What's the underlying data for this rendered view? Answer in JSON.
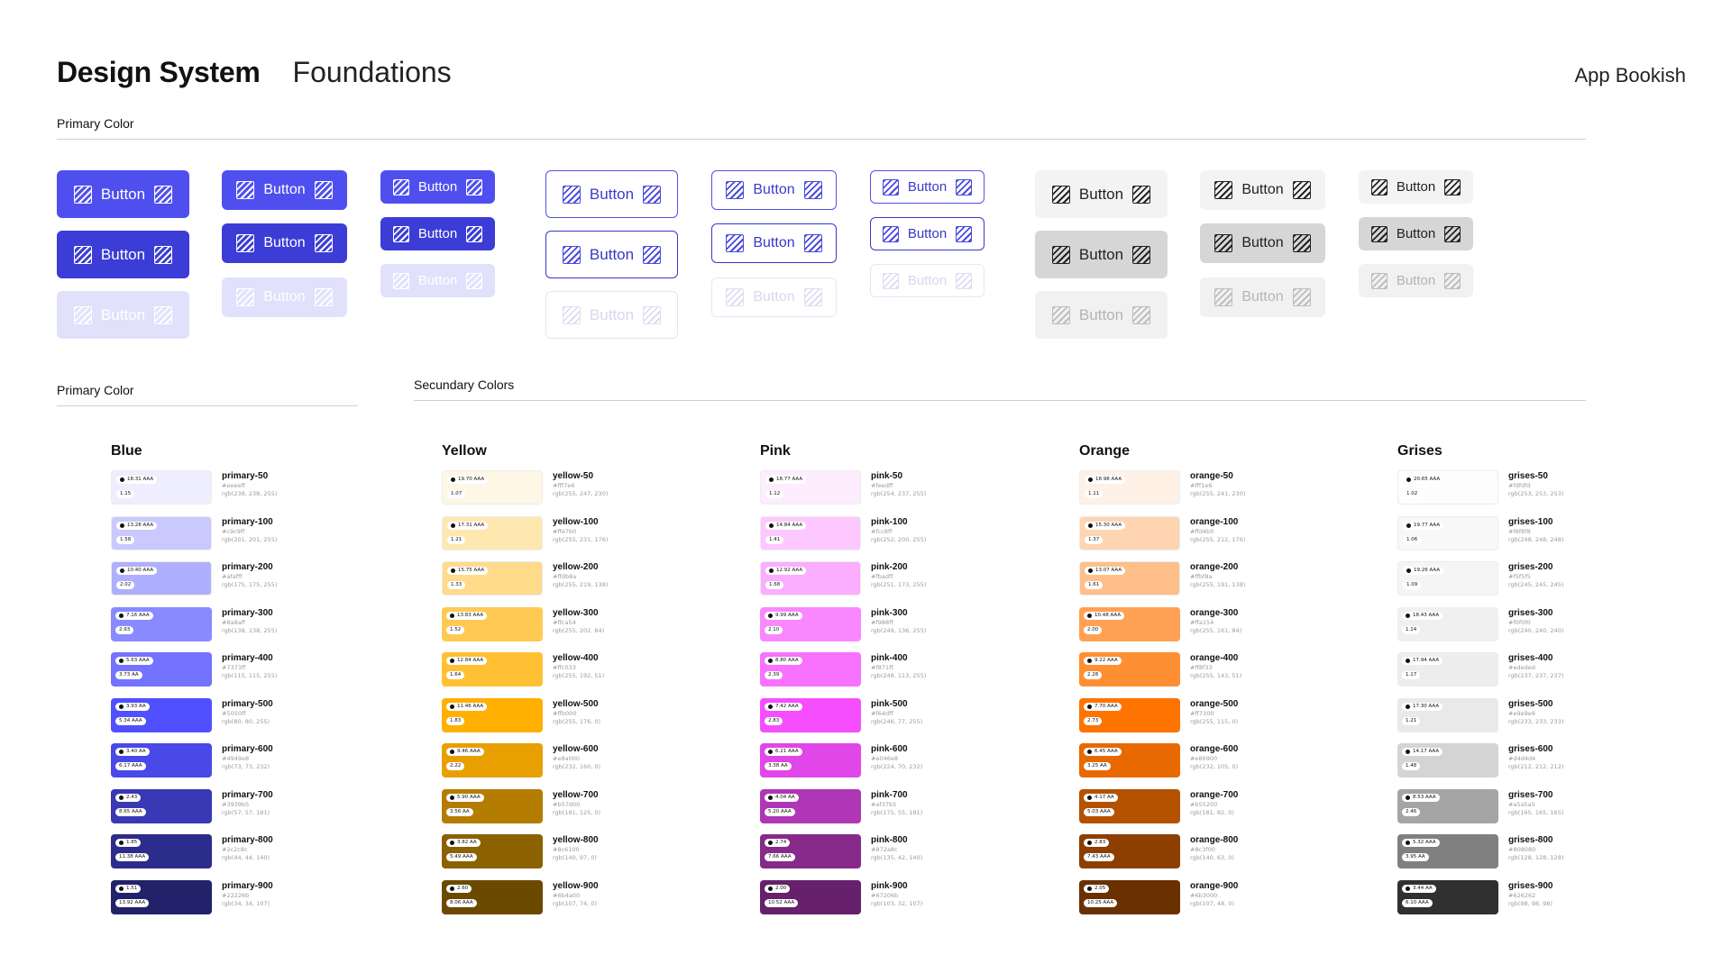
{
  "header": {
    "title": "Design System",
    "subtitle": "Foundations",
    "app_name": "App Bookish"
  },
  "sections": {
    "buttons_label": "Primary Color",
    "primary_label": "Primary Color",
    "secondary_label": "Secundary Colors"
  },
  "buttons": {
    "label": "Button",
    "icon": "hatch-square-icon"
  },
  "colors": {
    "solid": [
      "#4f4ff0",
      "#3c3cd6",
      "#e1e1fc"
    ],
    "outline": [
      "#5252e8",
      "#3737c8",
      "#e6e6f2"
    ],
    "gray": [
      "#f3f3f3",
      "#d6d6d6",
      "#f1f1f1"
    ]
  },
  "palettes": [
    {
      "title": "Blue",
      "shades": [
        {
          "name": "primary-50",
          "hex": "#eeeeff",
          "rgb": "rgb(238, 238, 255)",
          "color": "#eeeeff",
          "c1": "18.31 AAA",
          "c2": "1.15"
        },
        {
          "name": "primary-100",
          "hex": "#c9c9ff",
          "rgb": "rgb(201, 201, 255)",
          "color": "#c9c9ff",
          "c1": "13.28 AAA",
          "c2": "1.58"
        },
        {
          "name": "primary-200",
          "hex": "#afafff",
          "rgb": "rgb(175, 175, 255)",
          "color": "#afafff",
          "c1": "10.40 AAA",
          "c2": "2.02"
        },
        {
          "name": "primary-300",
          "hex": "#8a8aff",
          "rgb": "rgb(138, 138, 255)",
          "color": "#8a8aff",
          "c1": "7.16 AAA",
          "c2": "2.93"
        },
        {
          "name": "primary-400",
          "hex": "#7373ff",
          "rgb": "rgb(115, 115, 255)",
          "color": "#7373ff",
          "c1": "5.63 AAA",
          "c2": "3.73 AA"
        },
        {
          "name": "primary-500",
          "hex": "#5050ff",
          "rgb": "rgb(80, 80, 255)",
          "color": "#5050ff",
          "c1": "3.93 AA",
          "c2": "5.34 AAA"
        },
        {
          "name": "primary-600",
          "hex": "#4949e8",
          "rgb": "rgb(73, 73, 232)",
          "color": "#4949e8",
          "c1": "3.40 AA",
          "c2": "6.17 AAA"
        },
        {
          "name": "primary-700",
          "hex": "#3939b5",
          "rgb": "rgb(57, 57, 181)",
          "color": "#3939b5",
          "c1": "2.43",
          "c2": "8.65 AAA"
        },
        {
          "name": "primary-800",
          "hex": "#2c2c8c",
          "rgb": "rgb(44, 44, 140)",
          "color": "#2c2c8c",
          "c1": "1.85",
          "c2": "11.38 AAA"
        },
        {
          "name": "primary-900",
          "hex": "#22226b",
          "rgb": "rgb(34, 34, 107)",
          "color": "#22226b",
          "c1": "1.51",
          "c2": "13.92 AAA"
        }
      ]
    },
    {
      "title": "Yellow",
      "shades": [
        {
          "name": "yellow-50",
          "hex": "#fff7e6",
          "rgb": "rgb(255, 247, 230)",
          "color": "#fff7e6",
          "c1": "19.70 AAA",
          "c2": "1.07"
        },
        {
          "name": "yellow-100",
          "hex": "#ffe7b0",
          "rgb": "rgb(255, 231, 176)",
          "color": "#ffe7b0",
          "c1": "17.31 AAA",
          "c2": "1.21"
        },
        {
          "name": "yellow-200",
          "hex": "#ffdb8a",
          "rgb": "rgb(255, 219, 138)",
          "color": "#ffdb8a",
          "c1": "15.75 AAA",
          "c2": "1.33"
        },
        {
          "name": "yellow-300",
          "hex": "#ffca54",
          "rgb": "rgb(255, 202, 84)",
          "color": "#ffca54",
          "c1": "13.83 AAA",
          "c2": "1.52"
        },
        {
          "name": "yellow-400",
          "hex": "#ffc033",
          "rgb": "rgb(255, 192, 51)",
          "color": "#ffc033",
          "c1": "12.84 AAA",
          "c2": "1.64"
        },
        {
          "name": "yellow-500",
          "hex": "#ffb000",
          "rgb": "rgb(255, 176, 0)",
          "color": "#ffb000",
          "c1": "11.46 AAA",
          "c2": "1.83"
        },
        {
          "name": "yellow-600",
          "hex": "#e8a000",
          "rgb": "rgb(232, 160, 0)",
          "color": "#e8a000",
          "c1": "9.46 AAA",
          "c2": "2.22"
        },
        {
          "name": "yellow-700",
          "hex": "#b57d00",
          "rgb": "rgb(181, 125, 0)",
          "color": "#b57d00",
          "c1": "5.90 AAA",
          "c2": "3.56 AA"
        },
        {
          "name": "yellow-800",
          "hex": "#8c6100",
          "rgb": "rgb(140, 97, 0)",
          "color": "#8c6100",
          "c1": "3.82 AA",
          "c2": "5.49 AAA"
        },
        {
          "name": "yellow-900",
          "hex": "#6b4a00",
          "rgb": "rgb(107, 74, 0)",
          "color": "#6b4a00",
          "c1": "2.60",
          "c2": "8.06 AAA"
        }
      ]
    },
    {
      "title": "Pink",
      "shades": [
        {
          "name": "pink-50",
          "hex": "#feedff",
          "rgb": "rgb(254, 237, 255)",
          "color": "#feedff",
          "c1": "18.77 AAA",
          "c2": "1.12"
        },
        {
          "name": "pink-100",
          "hex": "#fcc8ff",
          "rgb": "rgb(252, 200, 255)",
          "color": "#fcc8ff",
          "c1": "14.84 AAA",
          "c2": "1.41"
        },
        {
          "name": "pink-200",
          "hex": "#fbadff",
          "rgb": "rgb(251, 173, 255)",
          "color": "#fbadff",
          "c1": "12.92 AAA",
          "c2": "1.68"
        },
        {
          "name": "pink-300",
          "hex": "#f988ff",
          "rgb": "rgb(249, 136, 255)",
          "color": "#f988ff",
          "c1": "9.99 AAA",
          "c2": "2.10"
        },
        {
          "name": "pink-400",
          "hex": "#f871ff",
          "rgb": "rgb(248, 113, 255)",
          "color": "#f871ff",
          "c1": "8.80 AAA",
          "c2": "2.39"
        },
        {
          "name": "pink-500",
          "hex": "#f64dff",
          "rgb": "rgb(246, 77, 255)",
          "color": "#f64dff",
          "c1": "7.42 AAA",
          "c2": "2.83"
        },
        {
          "name": "pink-600",
          "hex": "#e046e8",
          "rgb": "rgb(224, 70, 232)",
          "color": "#e046e8",
          "c1": "6.21 AAA",
          "c2": "3.38 AA"
        },
        {
          "name": "pink-700",
          "hex": "#af37b5",
          "rgb": "rgb(175, 55, 181)",
          "color": "#af37b5",
          "c1": "4.04 AA",
          "c2": "5.20 AAA"
        },
        {
          "name": "pink-800",
          "hex": "#872a8c",
          "rgb": "rgb(135, 42, 140)",
          "color": "#872a8c",
          "c1": "2.74",
          "c2": "7.66 AAA"
        },
        {
          "name": "pink-900",
          "hex": "#67206b",
          "rgb": "rgb(103, 32, 107)",
          "color": "#67206b",
          "c1": "2.00",
          "c2": "10.52 AAA"
        }
      ]
    },
    {
      "title": "Orange",
      "shades": [
        {
          "name": "orange-50",
          "hex": "#fff1e6",
          "rgb": "rgb(255, 241, 230)",
          "color": "#fff1e6",
          "c1": "18.98 AAA",
          "c2": "1.11"
        },
        {
          "name": "orange-100",
          "hex": "#ffd4b0",
          "rgb": "rgb(255, 212, 176)",
          "color": "#ffd4b0",
          "c1": "15.30 AAA",
          "c2": "1.37"
        },
        {
          "name": "orange-200",
          "hex": "#ffbf8a",
          "rgb": "rgb(255, 191, 138)",
          "color": "#ffbf8a",
          "c1": "13.07 AAA",
          "c2": "1.61"
        },
        {
          "name": "orange-300",
          "hex": "#ffa154",
          "rgb": "rgb(255, 161, 84)",
          "color": "#ffa154",
          "c1": "10.48 AAA",
          "c2": "2.00"
        },
        {
          "name": "orange-400",
          "hex": "#ff8f33",
          "rgb": "rgb(255, 143, 51)",
          "color": "#ff8f33",
          "c1": "9.22 AAA",
          "c2": "2.28"
        },
        {
          "name": "orange-500",
          "hex": "#ff7300",
          "rgb": "rgb(255, 115, 0)",
          "color": "#ff7300",
          "c1": "7.70 AAA",
          "c2": "2.73"
        },
        {
          "name": "orange-600",
          "hex": "#e86900",
          "rgb": "rgb(232, 105, 0)",
          "color": "#e86900",
          "c1": "6.45 AAA",
          "c2": "3.25 AA"
        },
        {
          "name": "orange-700",
          "hex": "#b55200",
          "rgb": "rgb(181, 82, 0)",
          "color": "#b55200",
          "c1": "4.17 AA",
          "c2": "5.03 AAA"
        },
        {
          "name": "orange-800",
          "hex": "#8c3f00",
          "rgb": "rgb(140, 63, 0)",
          "color": "#8c3f00",
          "c1": "2.83",
          "c2": "7.43 AAA"
        },
        {
          "name": "orange-900",
          "hex": "#6b3000",
          "rgb": "rgb(107, 48, 0)",
          "color": "#6b3000",
          "c1": "2.05",
          "c2": "10.25 AAA"
        }
      ]
    },
    {
      "title": "Grises",
      "shades": [
        {
          "name": "grises-50",
          "hex": "#fdfdfd",
          "rgb": "rgb(253, 253, 253)",
          "color": "#fdfdfd",
          "c1": "20.65 AAA",
          "c2": "1.02"
        },
        {
          "name": "grises-100",
          "hex": "#f8f8f8",
          "rgb": "rgb(248, 248, 248)",
          "color": "#f8f8f8",
          "c1": "19.77 AAA",
          "c2": "1.06"
        },
        {
          "name": "grises-200",
          "hex": "#f5f5f5",
          "rgb": "rgb(245, 245, 245)",
          "color": "#f5f5f5",
          "c1": "19.26 AAA",
          "c2": "1.09"
        },
        {
          "name": "grises-300",
          "hex": "#f0f0f0",
          "rgb": "rgb(240, 240, 240)",
          "color": "#f0f0f0",
          "c1": "18.43 AAA",
          "c2": "1.14"
        },
        {
          "name": "grises-400",
          "hex": "#ededed",
          "rgb": "rgb(237, 237, 237)",
          "color": "#ededed",
          "c1": "17.94 AAA",
          "c2": "1.17"
        },
        {
          "name": "grises-500",
          "hex": "#e9e9e9",
          "rgb": "rgb(233, 233, 233)",
          "color": "#e9e9e9",
          "c1": "17.30 AAA",
          "c2": "1.21"
        },
        {
          "name": "grises-600",
          "hex": "#d4d4d4",
          "rgb": "rgb(212, 212, 212)",
          "color": "#d4d4d4",
          "c1": "14.17 AAA",
          "c2": "1.48"
        },
        {
          "name": "grises-700",
          "hex": "#a5a5a5",
          "rgb": "rgb(165, 165, 165)",
          "color": "#a5a5a5",
          "c1": "8.53 AAA",
          "c2": "2.46"
        },
        {
          "name": "grises-800",
          "hex": "#808080",
          "rgb": "rgb(128, 128, 128)",
          "color": "#808080",
          "c1": "5.32 AAA",
          "c2": "3.95 AA"
        },
        {
          "name": "grises-900",
          "hex": "#626262",
          "rgb": "rgb(98, 98, 98)",
          "color": "#303030",
          "c1": "3.44 AA",
          "c2": "6.10 AAA"
        }
      ]
    }
  ]
}
